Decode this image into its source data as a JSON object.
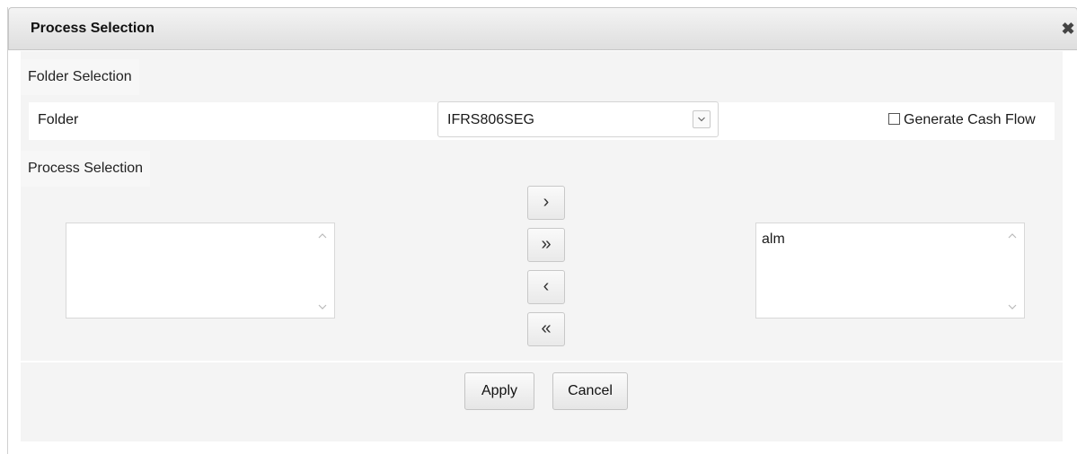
{
  "dialog": {
    "title": "Process Selection",
    "close_icon": "close-icon"
  },
  "folder_section": {
    "header": "Folder Selection",
    "folder_label": "Folder",
    "folder_value": "IFRS806SEG",
    "cash_flow_label": "Generate Cash Flow",
    "cash_flow_checked": false
  },
  "process_section": {
    "header": "Process Selection",
    "available_items": [],
    "selected_items": [
      "alm"
    ],
    "buttons": {
      "move_right": "›",
      "move_all_right": "»",
      "move_left": "‹",
      "move_all_left": "«"
    }
  },
  "footer": {
    "apply_label": "Apply",
    "cancel_label": "Cancel"
  }
}
